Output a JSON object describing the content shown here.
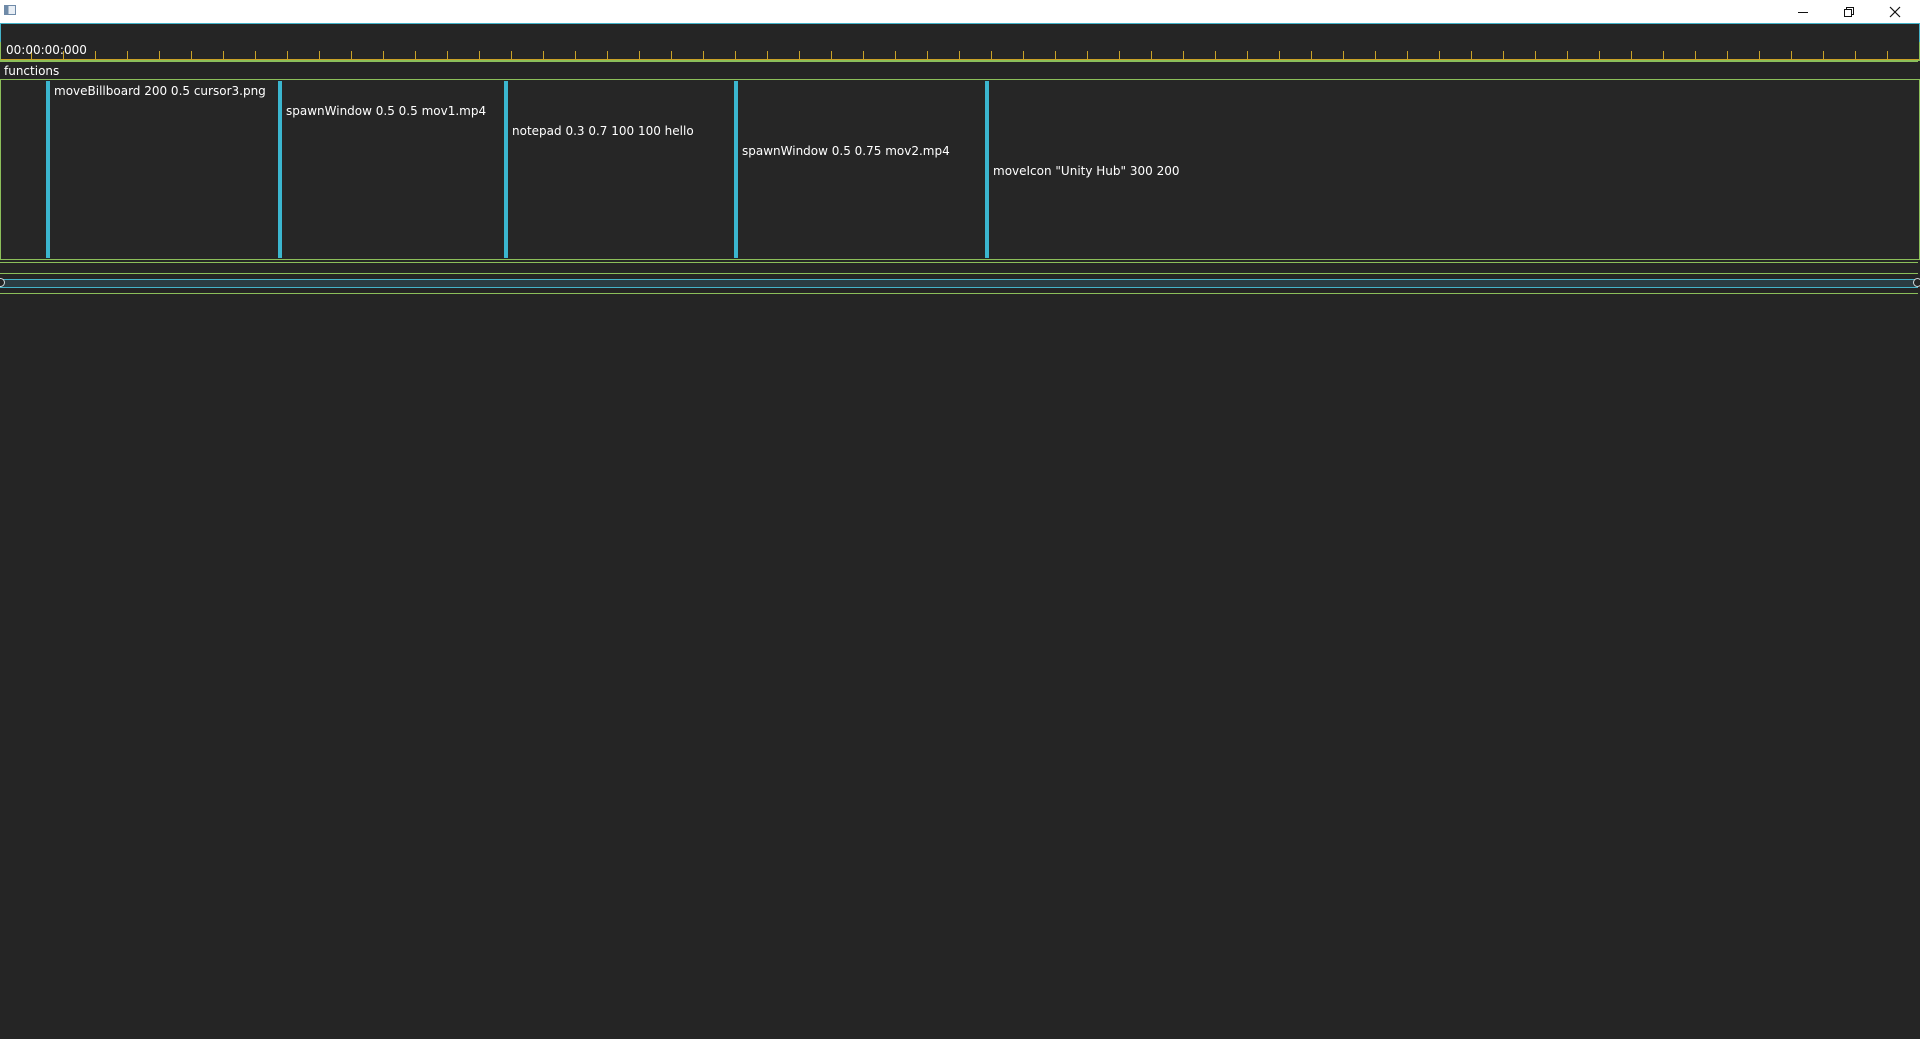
{
  "window": {
    "icons": {
      "app": "app-icon",
      "minimize": "minimize-icon",
      "restore": "restore-icon",
      "close": "close-icon"
    }
  },
  "timeline": {
    "current_time": "00:00:00:000",
    "track_label": "functions"
  },
  "clips": [
    {
      "label": "moveBillboard 200 0.5 cursor3.png"
    },
    {
      "label": "spawnWindow 0.5 0.5 mov1.mp4"
    },
    {
      "label": "notepad 0.3 0.7 100 100 hello"
    },
    {
      "label": "spawnWindow 0.5 0.75 mov2.mp4"
    },
    {
      "label": "moveIcon \"Unity Hub\" 300 200"
    }
  ],
  "colors": {
    "background": "#252525",
    "green_border": "#8cbf5a",
    "cyan_accent": "#3bb6cf",
    "ruler_ticks": "#c9a227"
  }
}
